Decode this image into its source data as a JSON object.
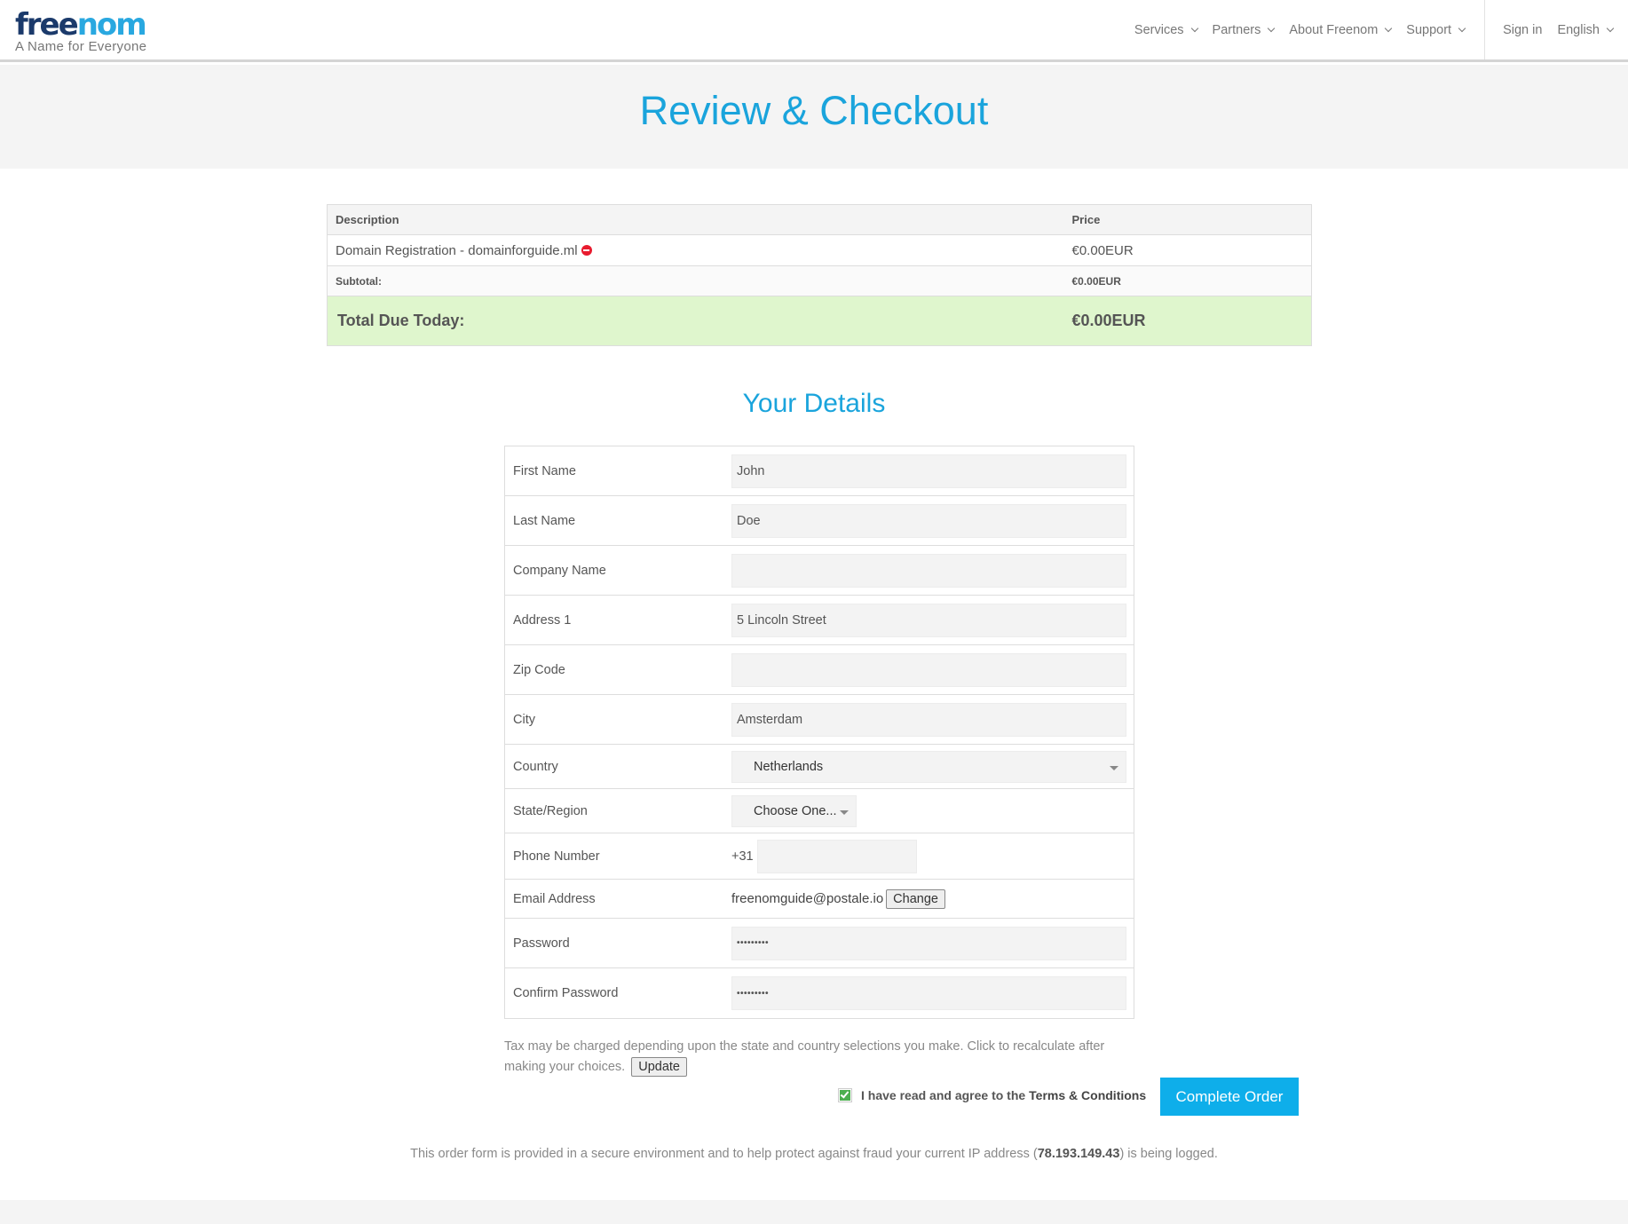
{
  "header": {
    "logo_free": "free",
    "logo_nom": "nom",
    "tagline": "A Name for Everyone",
    "nav": {
      "services": "Services",
      "partners": "Partners",
      "about": "About Freenom",
      "support": "Support",
      "signin": "Sign in",
      "language": "English"
    }
  },
  "page": {
    "title": "Review & Checkout",
    "details_title": "Your Details"
  },
  "order": {
    "headers": {
      "description": "Description",
      "price": "Price"
    },
    "item": {
      "description": "Domain Registration - domainforguide.ml",
      "price": "€0.00EUR"
    },
    "subtotal": {
      "label": "Subtotal:",
      "value": "€0.00EUR"
    },
    "total": {
      "label": "Total Due Today:",
      "value": "€0.00EUR"
    }
  },
  "form": {
    "first_name": {
      "label": "First Name",
      "value": "John"
    },
    "last_name": {
      "label": "Last Name",
      "value": "Doe"
    },
    "company": {
      "label": "Company Name",
      "value": ""
    },
    "address1": {
      "label": "Address 1",
      "value": "5 Lincoln Street"
    },
    "zip": {
      "label": "Zip Code",
      "value": ""
    },
    "city": {
      "label": "City",
      "value": "Amsterdam"
    },
    "country": {
      "label": "Country",
      "value": "Netherlands"
    },
    "state": {
      "label": "State/Region",
      "value": "Choose One..."
    },
    "phone": {
      "label": "Phone Number",
      "prefix": "+31",
      "value": ""
    },
    "email": {
      "label": "Email Address",
      "value": "freenomguide@postale.io",
      "change_label": "Change"
    },
    "password": {
      "label": "Password",
      "value": "•••••••••"
    },
    "confirm_password": {
      "label": "Confirm Password",
      "value": "•••••••••"
    }
  },
  "tax": {
    "note": "Tax may be charged depending upon the state and country selections you make. Click to recalculate after making your choices.",
    "update_label": "Update"
  },
  "agree": {
    "text": "I have read and agree to the",
    "link": "Terms & Conditions",
    "checked": true
  },
  "complete_label": "Complete Order",
  "secure": {
    "before": "This order form is provided in a secure environment and to help protect against fraud your current IP address (",
    "ip": "78.193.149.43",
    "after": ") is being logged."
  },
  "colors": {
    "accent": "#1aa4dc",
    "button": "#0eaeea",
    "total_bg": "#dff6cd",
    "check": "#4caf50"
  }
}
